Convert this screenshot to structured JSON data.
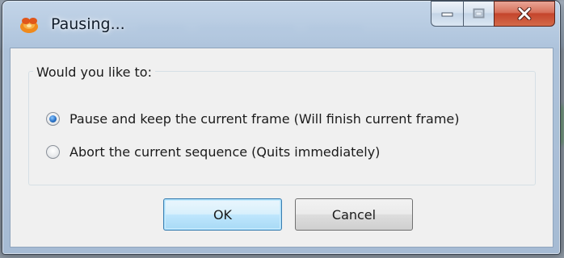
{
  "window": {
    "title": "Pausing...",
    "caption_buttons": {
      "minimize_icon": "minimize-icon",
      "maximize_icon": "maximize-icon",
      "close_icon": "close-icon",
      "close_color": "#c94a31"
    },
    "app_icon": "app-icon"
  },
  "dialog": {
    "group_label": "Would you like to:",
    "options": [
      {
        "label": "Pause and keep the current frame (Will finish current frame)",
        "checked": true
      },
      {
        "label": "Abort the current sequence (Quits immediately)",
        "checked": false
      }
    ],
    "buttons": {
      "ok_label": "OK",
      "cancel_label": "Cancel"
    }
  },
  "colors": {
    "accent": "#2a72c8",
    "default_button_border": "#3c7fb1"
  }
}
